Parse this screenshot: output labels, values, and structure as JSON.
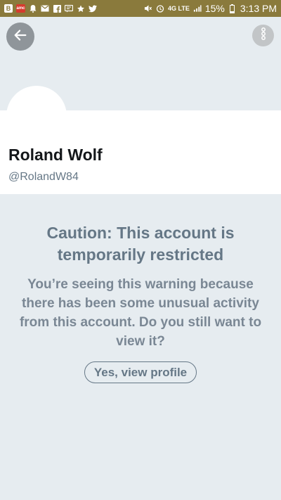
{
  "status_bar": {
    "notif_b": "B",
    "notif_amc": "amc",
    "battery_percent": "15%",
    "time": "3:13 PM",
    "network": "4G LTE"
  },
  "header": {
    "back_icon": "arrow-left-icon",
    "more_icon": "more-vertical-icon"
  },
  "profile": {
    "name": "Roland Wolf",
    "handle": "@RolandW84"
  },
  "warning": {
    "title": "Caution: This account is temporarily restricted",
    "body": "You’re seeing this warning because there has been some unusual activity from this account. Do you still want to view it?",
    "button_label": "Yes, view profile"
  },
  "colors": {
    "status_bar_bg": "#8a7a3c",
    "background": "#e6ecf0",
    "text_secondary": "#657786",
    "text_primary": "#14171a"
  }
}
